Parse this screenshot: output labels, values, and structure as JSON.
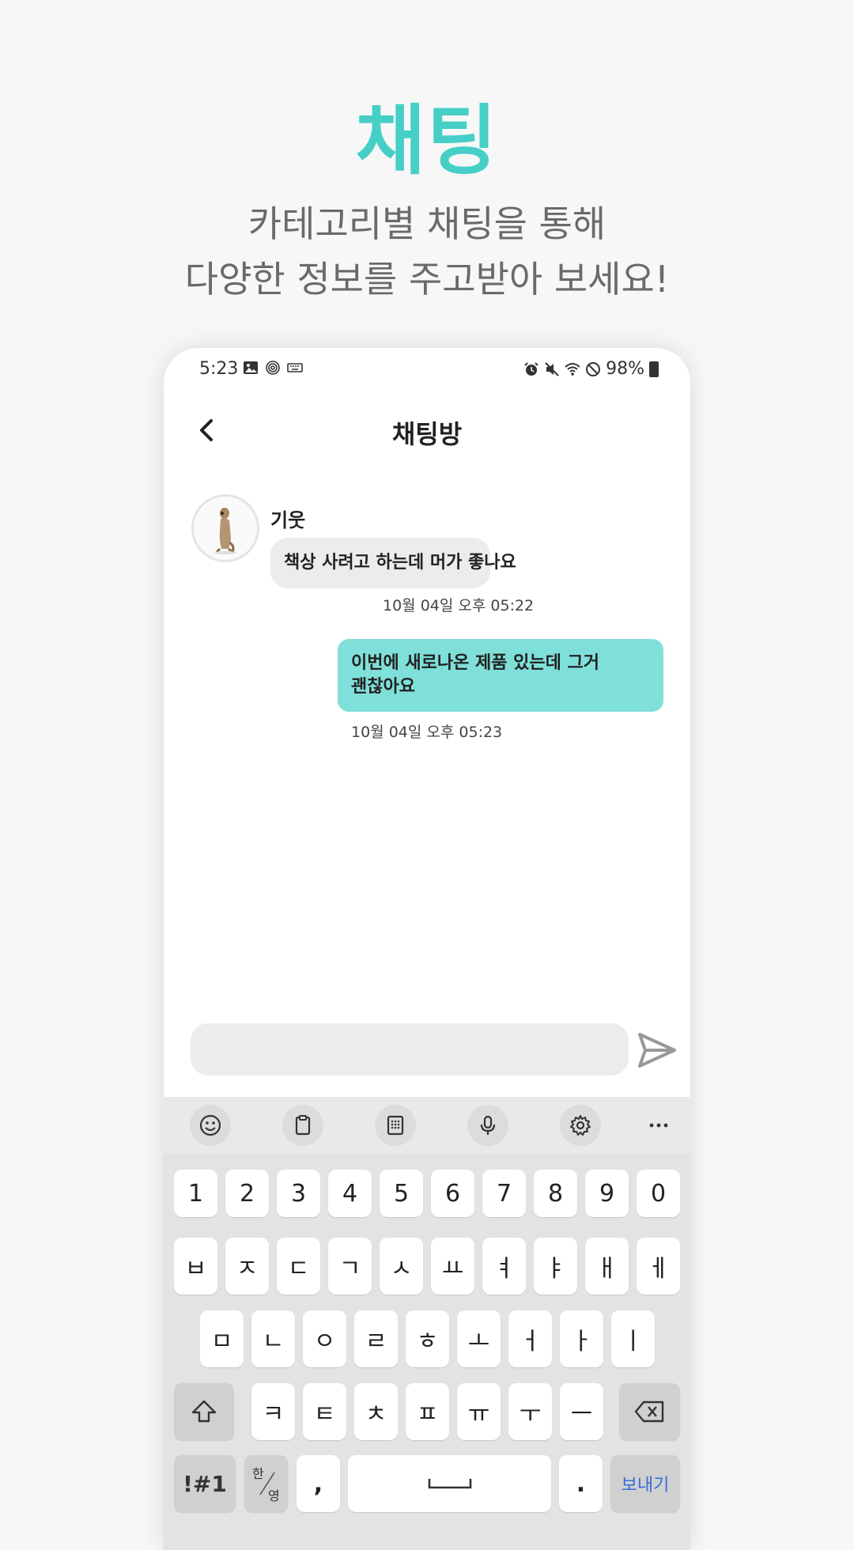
{
  "hero": {
    "title": "채팅",
    "subtitle_line1": "카테고리별 채팅을 통해",
    "subtitle_line2": "다양한 정보를 주고받아 보세요!"
  },
  "status_bar": {
    "time": "5:23",
    "battery": "98%"
  },
  "app_bar": {
    "title": "채팅방"
  },
  "messages": {
    "incoming": {
      "sender": "기웃",
      "text": "책상 사려고 하는데 머가 좋나요",
      "time": "10월 04일 오후 05:22"
    },
    "outgoing": {
      "line1": "이번에 새로나온 제품 있는데 그거",
      "line2": "괜찮아요",
      "time": "10월 04일 오후 05:23"
    }
  },
  "composer": {
    "value": "",
    "placeholder": ""
  },
  "keyboard": {
    "toolbar_icons": [
      "emoji-icon",
      "clipboard-icon",
      "keypad-icon",
      "mic-icon",
      "settings-icon",
      "more-icon"
    ],
    "row1": [
      "1",
      "2",
      "3",
      "4",
      "5",
      "6",
      "7",
      "8",
      "9",
      "0"
    ],
    "row2": [
      "ㅂ",
      "ㅈ",
      "ㄷ",
      "ㄱ",
      "ㅅ",
      "ㅛ",
      "ㅕ",
      "ㅑ",
      "ㅐ",
      "ㅔ"
    ],
    "row3": [
      "ㅁ",
      "ㄴ",
      "ㅇ",
      "ㄹ",
      "ㅎ",
      "ㅗ",
      "ㅓ",
      "ㅏ",
      "ㅣ"
    ],
    "row4": [
      "ㅋ",
      "ㅌ",
      "ㅊ",
      "ㅍ",
      "ㅠ",
      "ㅜ",
      "ㅡ"
    ],
    "sym_label": "!#1",
    "lang_top": "한",
    "lang_bottom": "영",
    "comma": ",",
    "period": ".",
    "send_label": "보내기"
  },
  "colors": {
    "accent": "#45cfc7",
    "outgoing_bubble": "#7fe0d9",
    "incoming_bubble": "#ececec",
    "send_key_text": "#3a6ad8"
  }
}
